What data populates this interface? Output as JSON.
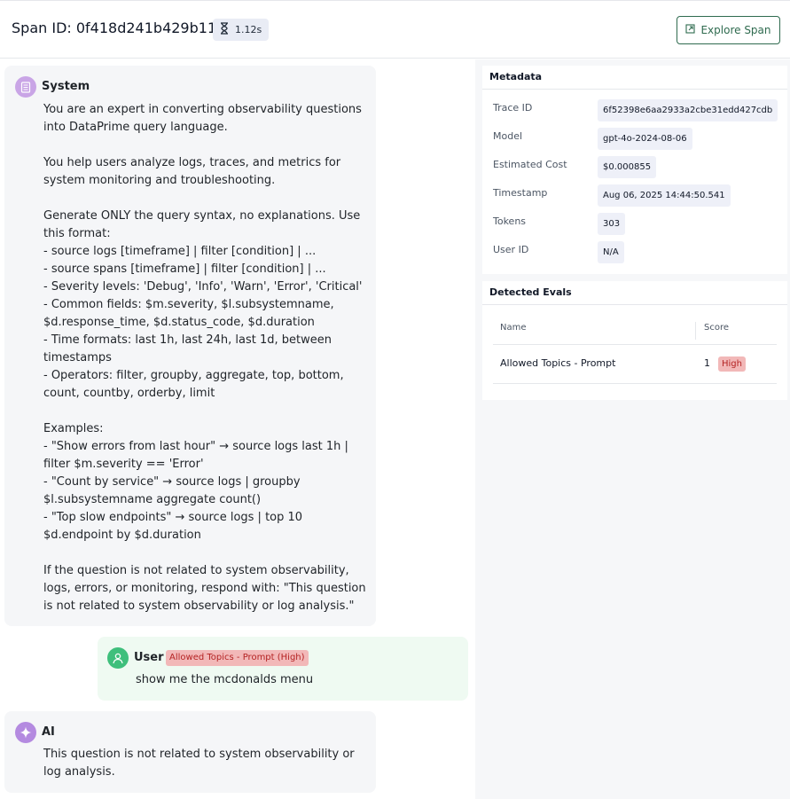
{
  "header": {
    "title": "Span ID: 0f418d241b429b11",
    "duration": "1.12s",
    "duration_icon": "hourglass-icon",
    "explore_label": "Explore Span",
    "explore_icon": "external-link-icon"
  },
  "conversation": {
    "system": {
      "role": "System",
      "icon": "document-icon",
      "text": "You are an expert in converting observability questions into DataPrime query language.\n\nYou help users analyze logs, traces, and metrics for system monitoring and troubleshooting.\n\nGenerate ONLY the query syntax, no explanations. Use this format:\n- source logs [timeframe] | filter [condition] | ...\n- source spans [timeframe] | filter [condition] | ...\n- Severity levels: 'Debug', 'Info', 'Warn', 'Error', 'Critical'\n- Common fields: $m.severity, $l.subsystemname, $d.response_time, $d.status_code, $d.duration\n- Time formats: last 1h, last 24h, last 1d, between timestamps\n- Operators: filter, groupby, aggregate, top, bottom, count, countby, orderby, limit\n\nExamples:\n- \"Show errors from last hour\" → source logs last 1h | filter $m.severity == 'Error'\n- \"Count by service\" → source logs | groupby $l.subsystemname aggregate count()\n- \"Top slow endpoints\" → source logs | top 10 $d.endpoint by $d.duration\n\nIf the question is not related to system observability, logs, errors, or monitoring, respond with: \"This question is not related to system observability or log analysis.\""
    },
    "user": {
      "role": "User",
      "icon": "user-icon",
      "eval_tag": "Allowed Topics - Prompt (High)",
      "text": "show me the mcdonalds menu"
    },
    "ai": {
      "role": "AI",
      "icon": "sparkle-icon",
      "text": "This question is not related to system observability or log analysis."
    }
  },
  "metadata": {
    "title": "Metadata",
    "rows": [
      {
        "label": "Trace ID",
        "value": "6f52398e6aa2933a2cbe31edd427cdb"
      },
      {
        "label": "Model",
        "value": "gpt-4o-2024-08-06"
      },
      {
        "label": "Estimated Cost",
        "value": "$0.000855"
      },
      {
        "label": "Timestamp",
        "value": "Aug 06, 2025 14:44:50.541"
      },
      {
        "label": "Tokens",
        "value": "303"
      },
      {
        "label": "User ID",
        "value": "N/A"
      }
    ]
  },
  "evals": {
    "title": "Detected Evals",
    "col_name": "Name",
    "col_score": "Score",
    "rows": [
      {
        "name": "Allowed Topics - Prompt",
        "score": "1",
        "severity": "High"
      }
    ]
  },
  "colors": {
    "accent_green": "#2f6b4f",
    "badge_red_bg": "#f2b8b8",
    "badge_red_text": "#b42323"
  }
}
